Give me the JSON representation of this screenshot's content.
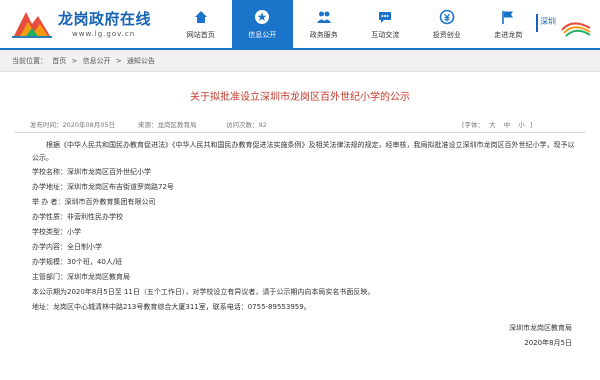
{
  "header": {
    "site_title": "龙岗政府在线",
    "site_url": "www.lg.gov.cn",
    "brand_right": "深圳",
    "nav": [
      {
        "label": "网站首页",
        "icon": "home-icon"
      },
      {
        "label": "信息公开",
        "icon": "star-icon",
        "active": true
      },
      {
        "label": "政务服务",
        "icon": "people-icon"
      },
      {
        "label": "互动交流",
        "icon": "chat-icon"
      },
      {
        "label": "投资创业",
        "icon": "money-icon"
      },
      {
        "label": "走进龙岗",
        "icon": "flag-icon"
      }
    ]
  },
  "breadcrumb": {
    "prefix": "当前位置：",
    "items": [
      "首页",
      "信息公开",
      "通知公告"
    ],
    "separator": ">"
  },
  "article": {
    "title": "关于拟批准设立深圳市龙岗区百外世纪小学的公示",
    "meta": {
      "time": "发布时间：2020年08月05日",
      "source": "来源：龙岗区教育局",
      "views": "访问次数：92",
      "font_label": "[字体：",
      "font_big": "大",
      "font_mid": "中",
      "font_small": "小",
      "font_end": "]"
    },
    "intro": "根据《中华人民共和国民办教育促进法》《中华人民共和国民办教育促进法实施条例》及相关法律法规的规定，经审核，我局拟批准设立深圳市龙岗区百外世纪小学，现予以公示。",
    "fields": [
      "学校名称：深圳市龙岗区百外世纪小学",
      "办学地址：深圳市龙岗区布吉街道罗岗路72号",
      "举 办 者：深圳市百外教育集团有限公司",
      "办学性质：非营利性民办学校",
      "学校类型：小学",
      "办学内容：全日制小学",
      "办学规模：30个班，40人/班",
      "主管部门：深圳市龙岗区教育局",
      "本公示期为2020年8月5日至 11日（五个工作日），对学校设立有异议者，请于公示期内向本局实名书面反映。",
      "地址：龙岗区中心城清林中路213号教育综合大厦311室，联系电话：0755-89553959。"
    ],
    "signature": "深圳市龙岗区教育局",
    "date": "2020年8月5日"
  }
}
